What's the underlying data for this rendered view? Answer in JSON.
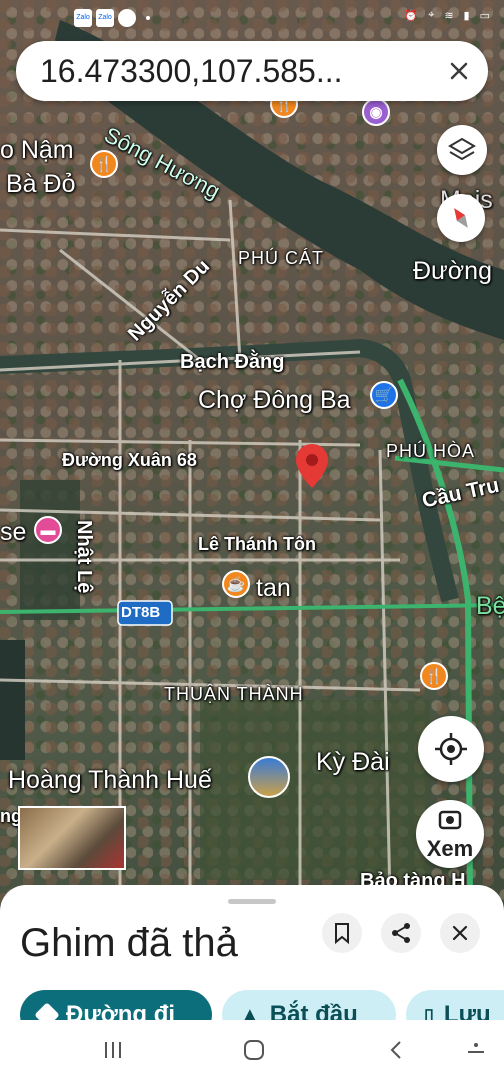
{
  "status_bar": {
    "time": "",
    "app_icons": [
      "Zalo",
      "Zalo"
    ]
  },
  "search": {
    "query": "16.473300,107.585..."
  },
  "map": {
    "labels": {
      "song_huong": "Sông Hương",
      "o_nam": "o Nậm",
      "ba_do": "Bà Đỏ",
      "maison": "Mais",
      "duong": "Đường",
      "nguyen_du": "Nguyễn Du",
      "phu_cat": "PHÚ CÁT",
      "bach_dang": "Bạch Đằng",
      "cho_dong_ba": "Chợ Đông Ba",
      "phu_hoa": "PHÚ HÒA",
      "cau_tru": "Cầu Tru",
      "duong_xuan_68": "Đường Xuân 68",
      "se": "se",
      "nhat_le": "Nhật Lệ",
      "le_thanh_ton": "Lê Thánh Tôn",
      "tan": "tan",
      "dt8b": "DT8B",
      "be": "Bệ",
      "thuan_thanh": "THUẬN THÀNH",
      "hoang_thanh_hue": "Hoàng Thành Huế",
      "ky_dai": "Kỳ Đài",
      "bao_tang": "Bảo tàng H",
      "ng": "ng"
    },
    "streetview_label": "Xem",
    "colors": {
      "pin": "#e53935",
      "road_green": "#3cb46e",
      "water": "#2a3a36"
    }
  },
  "sheet": {
    "title": "Ghim đã thả",
    "chips": {
      "directions": "Đường đi",
      "start": "Bắt đầu",
      "save": "Lưu"
    }
  }
}
